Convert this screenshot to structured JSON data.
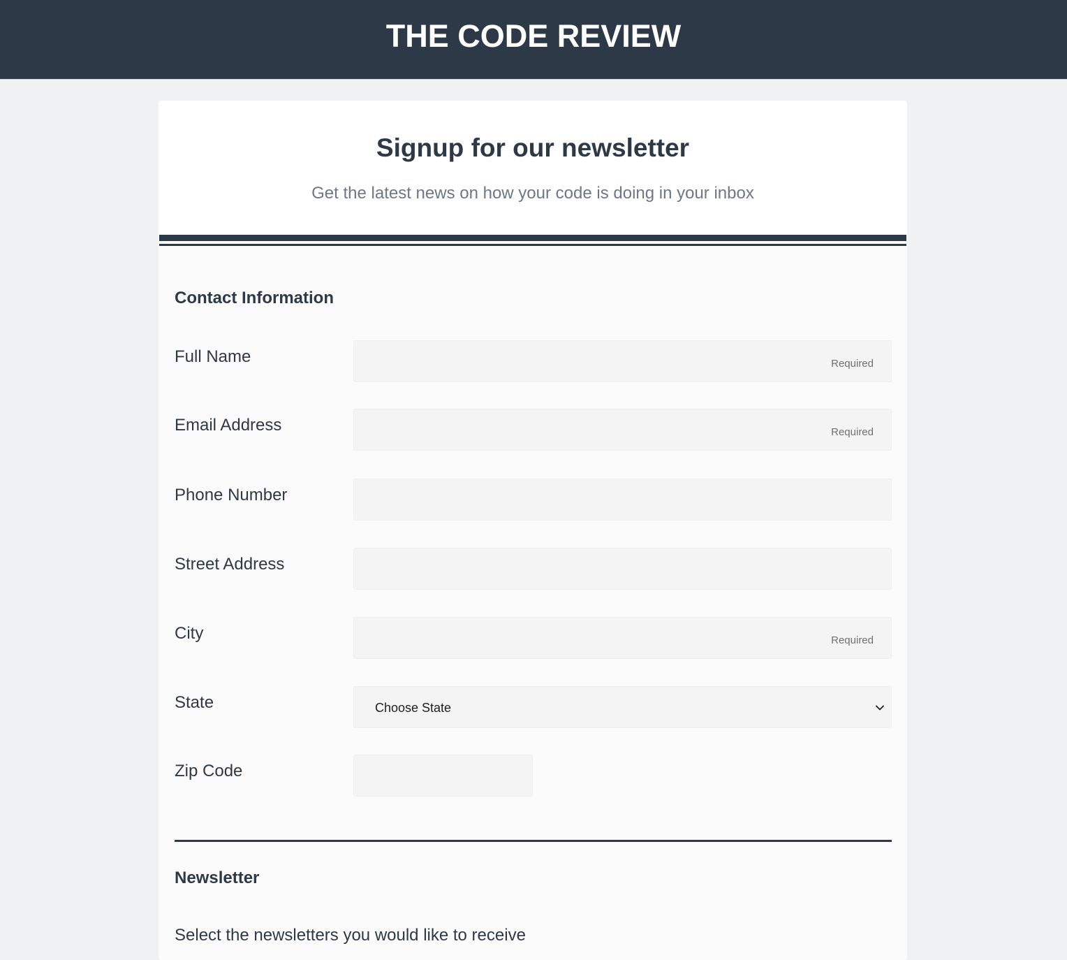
{
  "header": {
    "site_title": "THE CODE REVIEW"
  },
  "form": {
    "title": "Signup for our newsletter",
    "subtitle": "Get the latest news on how your code is doing in your inbox",
    "contact_section": {
      "heading": "Contact Information",
      "fields": {
        "full_name": {
          "label": "Full Name",
          "value": "",
          "hint": "Required"
        },
        "email": {
          "label": "Email Address",
          "value": "",
          "hint": "Required"
        },
        "phone": {
          "label": "Phone Number",
          "value": ""
        },
        "street": {
          "label": "Street Address",
          "value": ""
        },
        "city": {
          "label": "City",
          "value": "",
          "hint": "Required"
        },
        "state": {
          "label": "State",
          "selected": "Choose State"
        },
        "zip": {
          "label": "Zip Code",
          "value": ""
        }
      }
    },
    "newsletter_section": {
      "heading": "Newsletter",
      "helper": "Select the newsletters you would like to receive"
    }
  },
  "colors": {
    "header_bg": "#2d3946",
    "page_bg": "#f0f1f3",
    "input_bg": "#f4f4f4",
    "subtitle": "#6b7886"
  },
  "icons": {
    "select_arrow": "chevron-down-icon"
  }
}
